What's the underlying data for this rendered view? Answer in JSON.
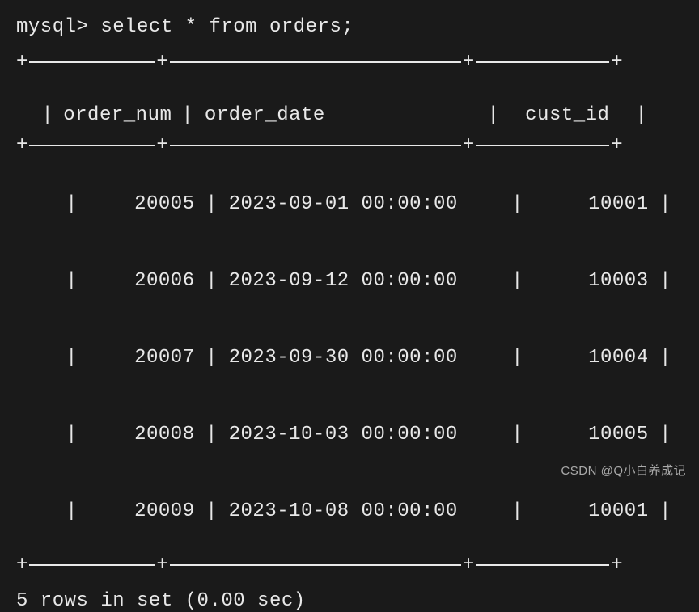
{
  "prompt": "mysql> select * from orders;",
  "columns": {
    "col1": "order_num",
    "col2": "order_date",
    "col3": "cust_id"
  },
  "rows": [
    {
      "order_num": "20005",
      "order_date": "2023-09-01 00:00:00",
      "cust_id": "10001"
    },
    {
      "order_num": "20006",
      "order_date": "2023-09-12 00:00:00",
      "cust_id": "10003"
    },
    {
      "order_num": "20007",
      "order_date": "2023-09-30 00:00:00",
      "cust_id": "10004"
    },
    {
      "order_num": "20008",
      "order_date": "2023-10-03 00:00:00",
      "cust_id": "10005"
    },
    {
      "order_num": "20009",
      "order_date": "2023-10-08 00:00:00",
      "cust_id": "10001"
    }
  ],
  "summary": "5 rows in set (0.00 sec)",
  "watermark": "CSDN @Q小白养成记"
}
